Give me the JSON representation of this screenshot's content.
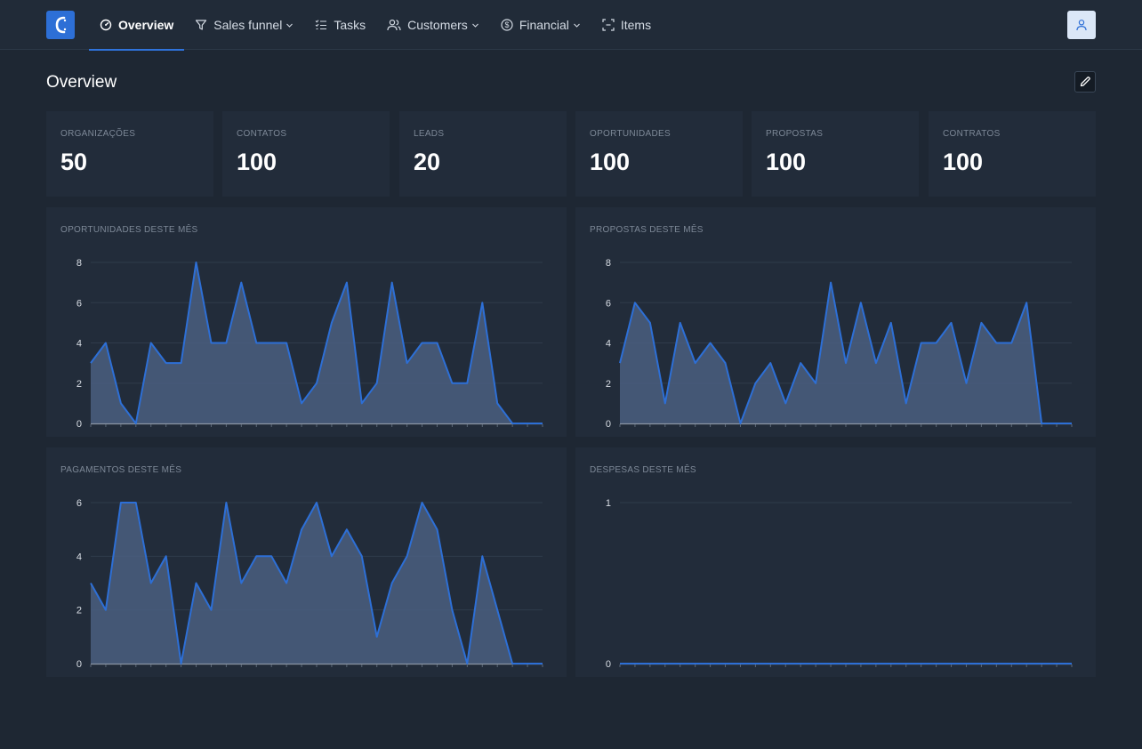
{
  "nav": {
    "items": [
      {
        "label": "Overview",
        "icon": "dashboard-icon",
        "active": true,
        "dropdown": false
      },
      {
        "label": "Sales funnel",
        "icon": "funnel-icon",
        "active": false,
        "dropdown": true
      },
      {
        "label": "Tasks",
        "icon": "checklist-icon",
        "active": false,
        "dropdown": false
      },
      {
        "label": "Customers",
        "icon": "users-icon",
        "active": false,
        "dropdown": true
      },
      {
        "label": "Financial",
        "icon": "dollar-circle-icon",
        "active": false,
        "dropdown": true
      },
      {
        "label": "Items",
        "icon": "scan-box-icon",
        "active": false,
        "dropdown": false
      }
    ]
  },
  "page": {
    "title": "Overview"
  },
  "stats": [
    {
      "label": "ORGANIZAÇÕES",
      "value": "50"
    },
    {
      "label": "CONTATOS",
      "value": "100"
    },
    {
      "label": "LEADS",
      "value": "20"
    },
    {
      "label": "OPORTUNIDADES",
      "value": "100"
    },
    {
      "label": "PROPOSTAS",
      "value": "100"
    },
    {
      "label": "CONTRATOS",
      "value": "100"
    }
  ],
  "colors": {
    "accent": "#2f73db",
    "line": "#2d6fd6",
    "area": "#4a5f80",
    "background": "#1e2733",
    "card": "#222c3a"
  },
  "chart_data": [
    {
      "type": "area",
      "title": "OPORTUNIDADES DESTE MÊS",
      "ylim": [
        0,
        8
      ],
      "yticks": [
        0,
        2,
        4,
        6,
        8
      ],
      "values": [
        3,
        4,
        1,
        0,
        4,
        3,
        3,
        8,
        4,
        4,
        7,
        4,
        4,
        4,
        1,
        2,
        5,
        7,
        1,
        2,
        7,
        3,
        4,
        4,
        2,
        2,
        6,
        1,
        0,
        0,
        0
      ],
      "grid": true
    },
    {
      "type": "area",
      "title": "PROPOSTAS DESTE MÊS",
      "ylim": [
        0,
        8
      ],
      "yticks": [
        0,
        2,
        4,
        6,
        8
      ],
      "values": [
        3,
        6,
        5,
        1,
        5,
        3,
        4,
        3,
        0,
        2,
        3,
        1,
        3,
        2,
        7,
        3,
        6,
        3,
        5,
        1,
        4,
        4,
        5,
        2,
        5,
        4,
        4,
        6,
        0,
        0,
        0
      ],
      "grid": true
    },
    {
      "type": "area",
      "title": "PAGAMENTOS DESTE MÊS",
      "ylim": [
        0,
        6
      ],
      "yticks": [
        0,
        2,
        4,
        6
      ],
      "values": [
        3,
        2,
        6,
        6,
        3,
        4,
        0,
        3,
        2,
        6,
        3,
        4,
        4,
        3,
        5,
        6,
        4,
        5,
        4,
        1,
        3,
        4,
        6,
        5,
        2,
        0,
        4,
        2,
        0,
        0,
        0
      ],
      "grid": true
    },
    {
      "type": "area",
      "title": "DESPESAS DESTE MÊS",
      "ylim": [
        0,
        1
      ],
      "yticks": [
        0,
        1
      ],
      "values": [
        0,
        0,
        0,
        0,
        0,
        0,
        0,
        0,
        0,
        0,
        0,
        0,
        0,
        0,
        0,
        0,
        0,
        0,
        0,
        0,
        0,
        0,
        0,
        0,
        0,
        0,
        0,
        0,
        0,
        0,
        0
      ],
      "grid": true
    }
  ]
}
